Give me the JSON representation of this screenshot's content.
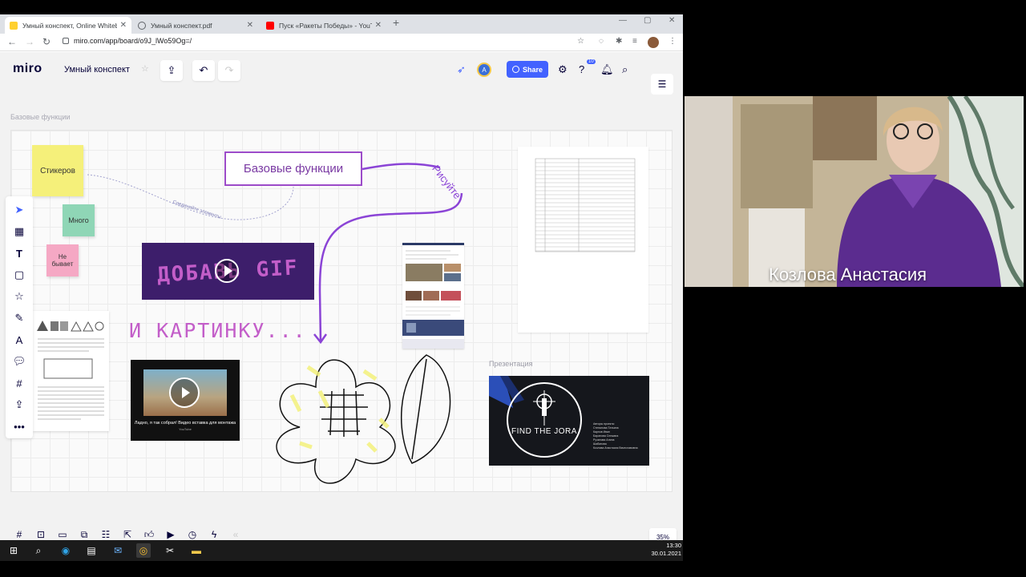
{
  "browser": {
    "tabs": [
      {
        "title": "Умный конспект, Online Whiteb",
        "active": true,
        "favicon_color": "#ffd02f"
      },
      {
        "title": "Умный конспект.pdf",
        "active": false,
        "favicon_color": "#5f6368"
      },
      {
        "title": "Пуск «Ракеты Победы» - YouTu",
        "active": false,
        "favicon_color": "#ff0000"
      }
    ],
    "new_tab": "+",
    "url": "miro.com/app/board/o9J_lWo59Og=/"
  },
  "miro": {
    "logo": "miro",
    "board_name": "Умный конспект",
    "share_label": "Share",
    "avatar_letter": "A",
    "notification_count": "10",
    "frame_label": "Базовые функции",
    "zoom": "35%"
  },
  "board": {
    "stickies": {
      "stickers": "Стикеров",
      "many": "Много",
      "never": "Не бывает"
    },
    "title": "Базовые функции",
    "draw_label": "Рисуйте",
    "connector_label": "Соединяйте элементы",
    "gif_text": "ДОБАВЬ GIF",
    "picture_text": "И КАРТИНКУ...",
    "video_caption": "Ладно, я так собрал! Видео вставка для монтажа",
    "video_source": "YouTube",
    "presentation_label": "Презентация",
    "presentation_title": "FIND THE JORA",
    "presentation_names": [
      "Авторы проекта:",
      "Степанова Татьяна",
      "Карпов Иван",
      "Баранова Снежана",
      "Рузанова Алина",
      "Шабанова",
      "Козлова Анастасия Вячеславовна"
    ]
  },
  "webcam": {
    "name": "Козлова Анастасия"
  },
  "taskbar": {
    "time": "13:30",
    "date": "30.01.2021"
  },
  "colors": {
    "accent": "#4262ff",
    "purple": "#8b44d6",
    "sticky_yellow": "#f5f07a",
    "sticky_green": "#8fd6b6",
    "sticky_pink": "#f5a8c4"
  }
}
